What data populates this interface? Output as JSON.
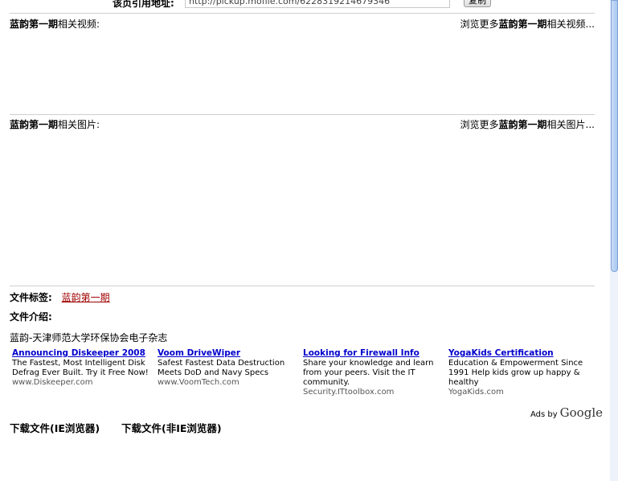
{
  "url_row": {
    "label": "该页引用地址:",
    "url": "http://pickup.mofile.com/6228319214679346",
    "copy_button": "复制"
  },
  "video_section": {
    "title_bold": "蓝韵第一期",
    "title_rest": "相关视频:",
    "more_prefix": "浏览更多",
    "more_bold": "蓝韵第一期",
    "more_suffix": "相关视频..."
  },
  "image_section": {
    "title_bold": "蓝韵第一期",
    "title_rest": "相关图片:",
    "more_prefix": "浏览更多",
    "more_bold": "蓝韵第一期",
    "more_suffix": "相关图片..."
  },
  "file_info": {
    "tags_label": "文件标签:",
    "tag_link": "蓝韵第一期",
    "intro_label": "文件介绍:",
    "intro_text": "蓝韵-天津师范大学环保协会电子杂志"
  },
  "ads": [
    {
      "title": "Announcing Diskeeper 2008",
      "desc": "The Fastest, Most Intelligent Disk Defrag Ever Built. Try it Free Now!",
      "url": "www.Diskeeper.com"
    },
    {
      "title": "Voom DriveWiper",
      "desc": "Safest Fastest Data Destruction Meets DoD and Navy Specs",
      "url": "www.VoomTech.com"
    },
    {
      "title": "Looking for Firewall Info",
      "desc": "Share your knowledge and learn from your peers. Visit the IT community.",
      "url": "Security.ITtoolbox.com"
    },
    {
      "title": "YogaKids Certification",
      "desc": "Education & Empowerment Since 1991 Help kids grow up happy & healthy",
      "url": "YogaKids.com"
    }
  ],
  "ads_by": {
    "label": "Ads by",
    "brand": "Google"
  },
  "downloads": {
    "ie": "下载文件(IE浏览器)",
    "non_ie": "下载文件(非IE浏览器)"
  }
}
